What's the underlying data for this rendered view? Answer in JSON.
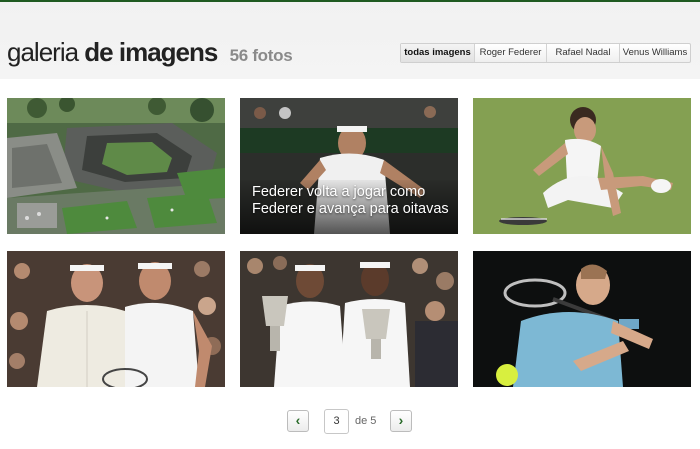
{
  "header": {
    "title_light": "galeria",
    "title_bold": "de imagens",
    "count": "56 fotos"
  },
  "filters": [
    {
      "label": "todas imagens",
      "active": true
    },
    {
      "label": "Roger Federer",
      "active": false
    },
    {
      "label": "Rafael Nadal",
      "active": false
    },
    {
      "label": "Venus Williams",
      "active": false
    }
  ],
  "gallery": {
    "photos": [
      {
        "subject": "stadium-aerial",
        "caption": ""
      },
      {
        "subject": "federer-hitting",
        "caption": "Federer volta a jogar como Federer e avança para oitavas"
      },
      {
        "subject": "player-on-grass",
        "caption": ""
      },
      {
        "subject": "federer-nadal",
        "caption": ""
      },
      {
        "subject": "williams-trophies",
        "caption": ""
      },
      {
        "subject": "player-serving",
        "caption": ""
      }
    ]
  },
  "pagination": {
    "prev_icon": "chevron-left-icon",
    "current_page": "3",
    "of_label": "de 5",
    "next_icon": "chevron-right-icon"
  },
  "colors": {
    "accent_green": "#1f5a21",
    "pager_arrow": "#2a6b2a"
  }
}
